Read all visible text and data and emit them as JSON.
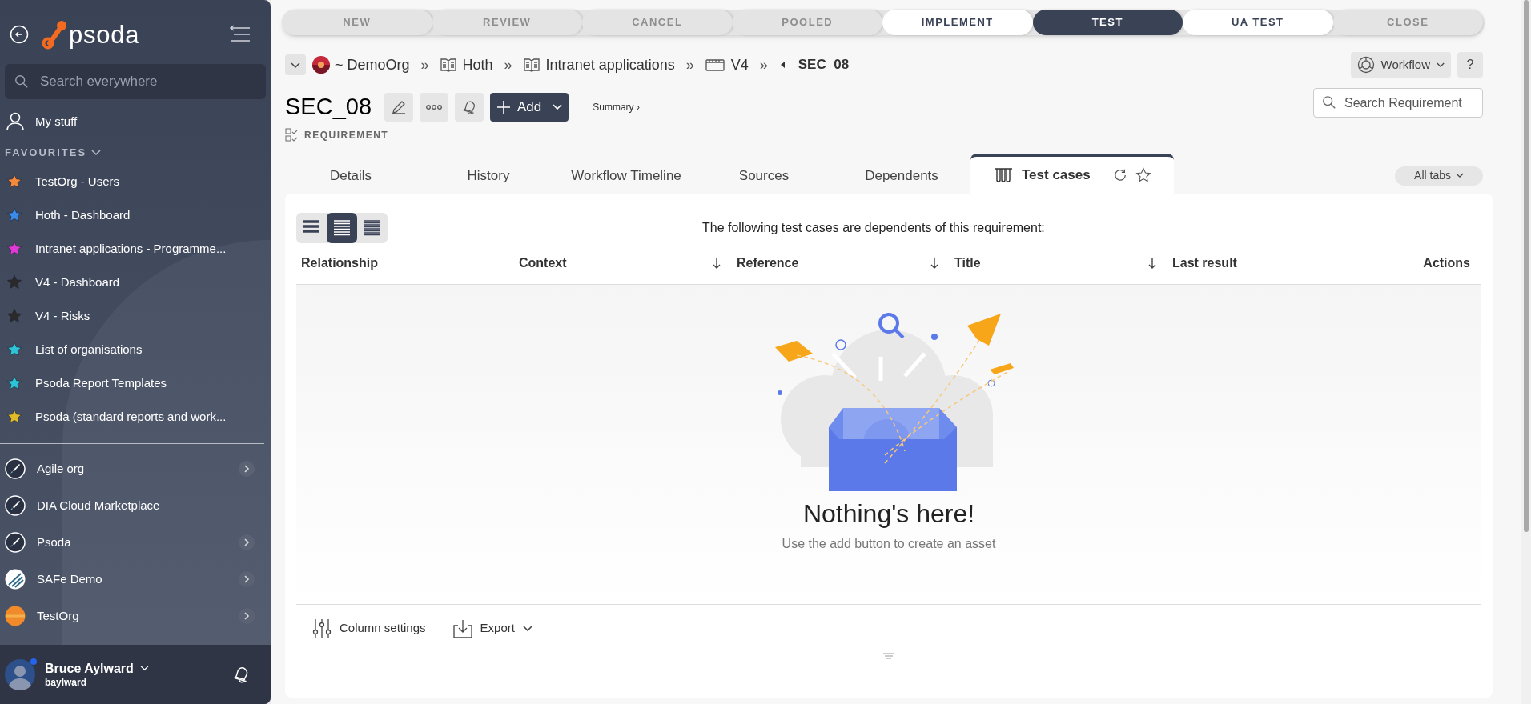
{
  "sidebar": {
    "logo": "psoda",
    "search": {
      "placeholder": "Search everywhere"
    },
    "my_stuff": "My stuff",
    "favourites_heading": "FAVOURITES",
    "favourites": [
      {
        "label": "TestOrg - Users",
        "color": "#f58a3c"
      },
      {
        "label": "Hoth - Dashboard",
        "color": "#3b8beb"
      },
      {
        "label": "Intranet applications - Programme...",
        "color": "#e03ad6"
      },
      {
        "label": "V4 - Dashboard",
        "color": "#2a2a2a"
      },
      {
        "label": "V4 - Risks",
        "color": "#2a2a2a"
      },
      {
        "label": "List of organisations",
        "color": "#2ec4d8"
      },
      {
        "label": "Psoda Report Templates",
        "color": "#2ec4d8"
      },
      {
        "label": "Psoda (standard reports and work...",
        "color": "#e2bb2a"
      }
    ],
    "organisations": [
      {
        "label": "Agile org",
        "kind": "rocket",
        "expandable": true
      },
      {
        "label": "DIA Cloud Marketplace",
        "kind": "rocket",
        "expandable": false
      },
      {
        "label": "Psoda",
        "kind": "rocket",
        "expandable": true
      },
      {
        "label": "SAFe Demo",
        "kind": "stripes",
        "expandable": true
      },
      {
        "label": "TestOrg",
        "kind": "sun",
        "expandable": true
      }
    ],
    "user": {
      "name": "Bruce Aylward",
      "username": "baylward",
      "online": true
    }
  },
  "workflow_steps": [
    {
      "label": "NEW",
      "selected": false,
      "available": false
    },
    {
      "label": "REVIEW",
      "selected": false,
      "available": false
    },
    {
      "label": "CANCEL",
      "selected": false,
      "available": false
    },
    {
      "label": "POOLED",
      "selected": false,
      "available": false
    },
    {
      "label": "IMPLEMENT",
      "selected": false,
      "available": true
    },
    {
      "label": "TEST",
      "selected": true,
      "available": true
    },
    {
      "label": "UA TEST",
      "selected": false,
      "available": true
    },
    {
      "label": "CLOSE",
      "selected": false,
      "available": false
    }
  ],
  "breadcrumbs": [
    {
      "label": "~ DemoOrg",
      "kind": "org"
    },
    {
      "label": "Hoth",
      "kind": "book"
    },
    {
      "label": "Intranet applications",
      "kind": "book"
    },
    {
      "label": "V4",
      "kind": "calendar"
    },
    {
      "label": "SEC_08",
      "kind": "current"
    }
  ],
  "breadcrumb_separator": "»",
  "header": {
    "title": "SEC_08",
    "type": "REQUIREMENT",
    "add_button": "Add",
    "summary_link": "Summary ›",
    "workflow_button": "Workflow",
    "help_button": "?",
    "search": {
      "placeholder": "Search Requirement"
    }
  },
  "tabs": [
    {
      "label": "Details",
      "selected": false
    },
    {
      "label": "History",
      "selected": false
    },
    {
      "label": "Workflow Timeline",
      "selected": false
    },
    {
      "label": "Sources",
      "selected": false
    },
    {
      "label": "Dependents",
      "selected": false
    },
    {
      "label": "Test cases",
      "selected": true
    }
  ],
  "all_tabs_button": "All tabs",
  "view_modes": [
    {
      "kind": "comfortable",
      "selected": false
    },
    {
      "kind": "normal",
      "selected": true
    },
    {
      "kind": "compact",
      "selected": false
    }
  ],
  "description": "The following test cases are dependents of this requirement:",
  "table": {
    "columns": [
      {
        "label": "Relationship",
        "sortable": false
      },
      {
        "label": "Context",
        "sortable": true
      },
      {
        "label": "Reference",
        "sortable": true
      },
      {
        "label": "Title",
        "sortable": true
      },
      {
        "label": "Last result",
        "sortable": false
      },
      {
        "label": "Actions",
        "sortable": false
      }
    ]
  },
  "empty_state": {
    "title": "Nothing's here!",
    "message": "Use the add button to create an asset"
  },
  "footer": {
    "column_settings": "Column settings",
    "export": "Export"
  }
}
